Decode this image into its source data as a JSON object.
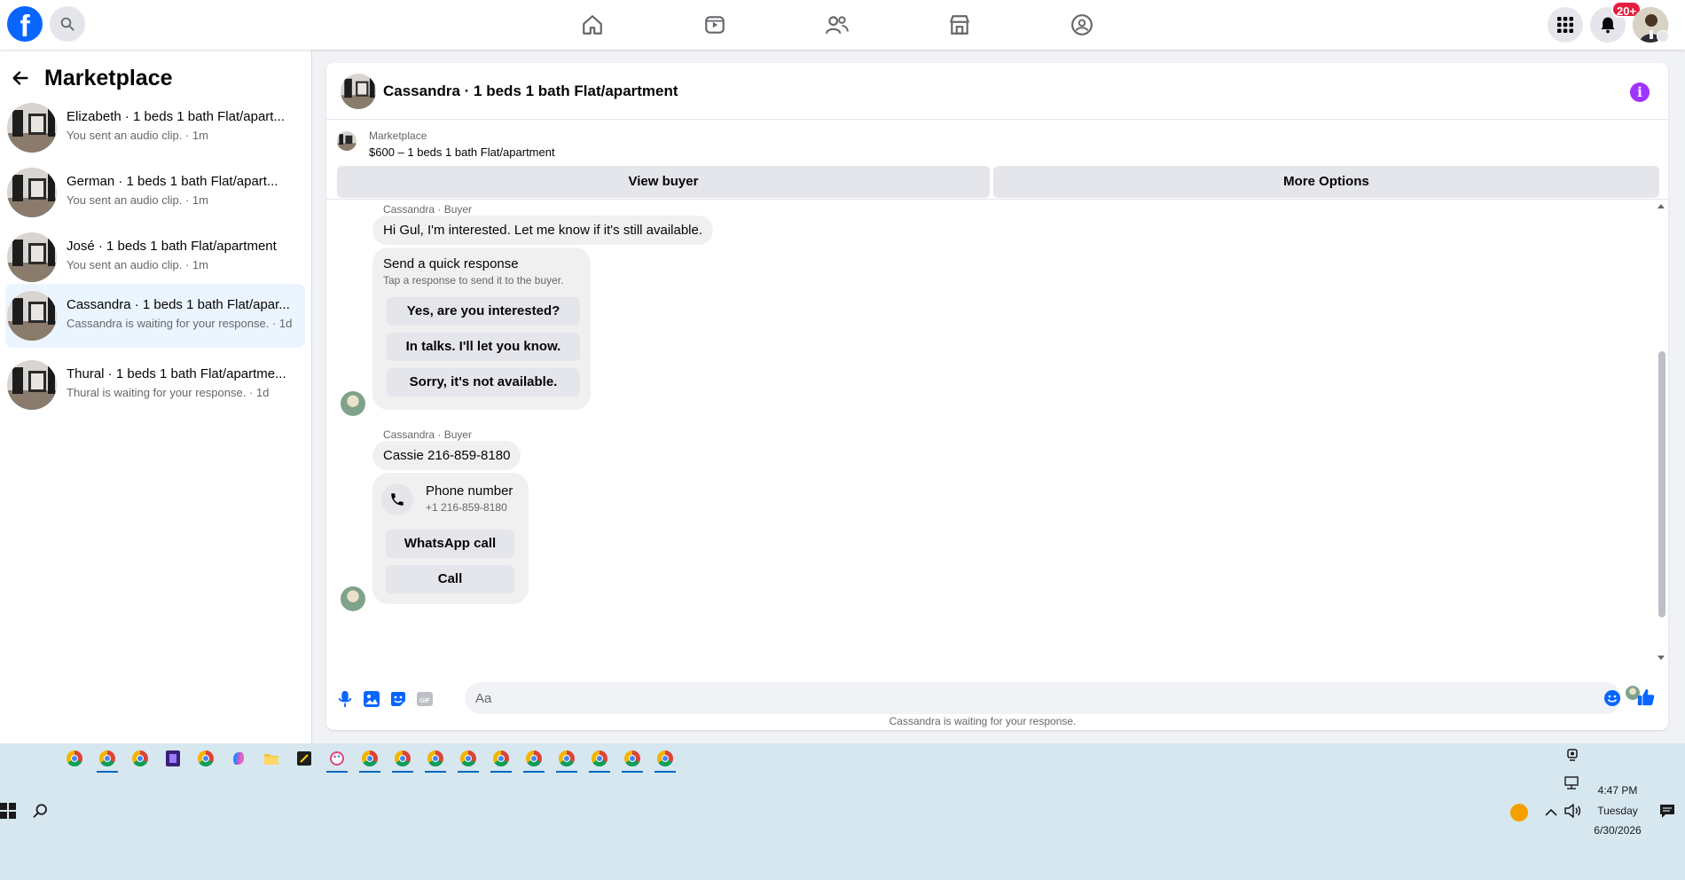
{
  "topbar": {
    "logo": "f",
    "notifications_badge": "20+",
    "nav_icons": [
      "home-icon",
      "video-icon",
      "friends-icon",
      "marketplace-icon",
      "groups-icon"
    ]
  },
  "sidebar": {
    "title": "Marketplace",
    "conversations": [
      {
        "name": "Elizabeth · 1 beds 1 bath Flat/apart...",
        "sub": "You sent an audio clip. · 1m"
      },
      {
        "name": "German · 1 beds 1 bath Flat/apart...",
        "sub": "You sent an audio clip. · 1m"
      },
      {
        "name": "José · 1 beds 1 bath Flat/apartment",
        "sub": "You sent an audio clip. · 1m"
      },
      {
        "name": "Cassandra · 1 beds 1 bath Flat/apar...",
        "sub": "Cassandra is waiting for your response. · 1d"
      },
      {
        "name": "Thural · 1 beds 1 bath Flat/apartme...",
        "sub": "Thural is waiting for your response. · 1d"
      }
    ]
  },
  "chat": {
    "title": "Cassandra · 1 beds 1 bath Flat/apartment",
    "listing_category": "Marketplace",
    "listing_price": "$600 – 1 beds 1 bath Flat/apartment",
    "view_buyer": "View buyer",
    "more_options": "More Options",
    "sender_label": "Cassandra · Buyer",
    "message1": "Hi Gul, I'm interested. Let me know if it's still available.",
    "quick_title": "Send a quick response",
    "quick_sub": "Tap a response to send it to the buyer.",
    "quick_replies": [
      "Yes, are you interested?",
      "In talks. I'll let you know.",
      "Sorry, it's not available."
    ],
    "message2": "Cassie 216-859-8180",
    "phone_title": "Phone number",
    "phone_value": "+1 216-859-8180",
    "whatsapp_call": "WhatsApp call",
    "call": "Call",
    "waiting": "Cassandra is waiting for your response.",
    "composer_placeholder": "Aa"
  },
  "taskbar": {
    "time": "4:47 PM",
    "day": "Tuesday",
    "date": "6/30/2026"
  },
  "colors": {
    "brand": "#0866ff",
    "accent_purple": "#a033ff",
    "badge_red": "#e41e3f",
    "active_conversation": "#ebf5ff"
  }
}
